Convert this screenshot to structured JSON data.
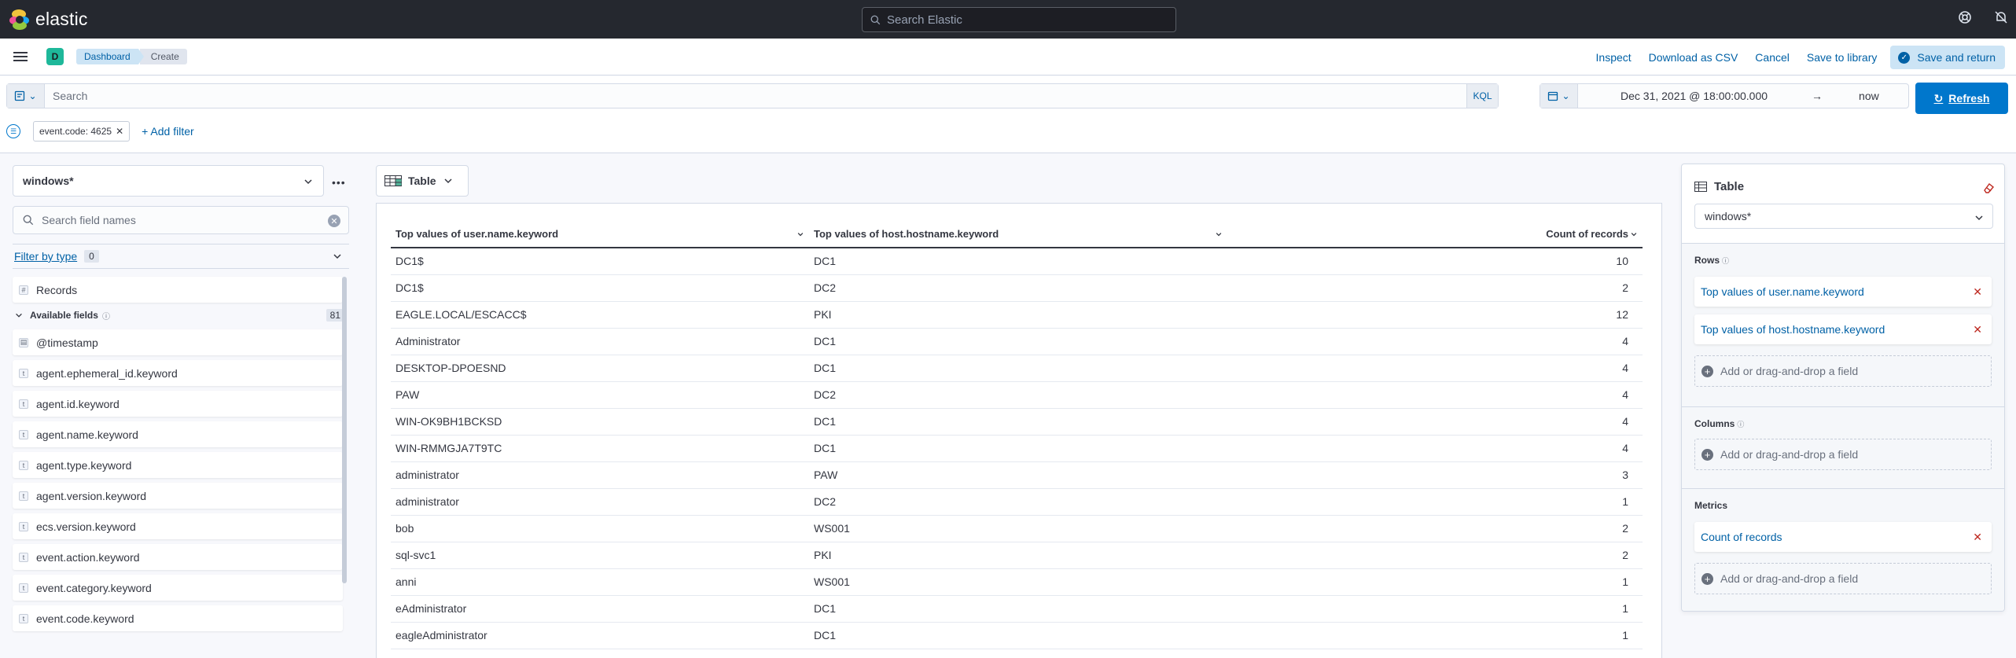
{
  "app": {
    "logo_text": "elastic",
    "global_search_placeholder": "Search Elastic"
  },
  "nav": {
    "space_initial": "D",
    "breadcrumbs": [
      "Dashboard",
      "Create"
    ],
    "actions": [
      "Inspect",
      "Download as CSV",
      "Cancel",
      "Save to library"
    ],
    "save_return_label": "Save and return"
  },
  "query": {
    "placeholder": "Search",
    "language": "KQL",
    "date_start": "Dec 31, 2021 @ 18:00:00.000",
    "date_arrow": "→",
    "date_end": "now",
    "refresh_label": "Refresh",
    "filter_pill": "event.code: 4625",
    "add_filter": "+ Add filter"
  },
  "left_panel": {
    "index_pattern": "windows*",
    "field_search_placeholder": "Search field names",
    "filter_by_type": "Filter by type",
    "filter_count": "0",
    "records_label": "Records",
    "available_label": "Available fields",
    "available_count": "81",
    "fields": [
      {
        "name": "@timestamp",
        "type": "date"
      },
      {
        "name": "agent.ephemeral_id.keyword",
        "type": "t"
      },
      {
        "name": "agent.id.keyword",
        "type": "t"
      },
      {
        "name": "agent.name.keyword",
        "type": "t"
      },
      {
        "name": "agent.type.keyword",
        "type": "t"
      },
      {
        "name": "agent.version.keyword",
        "type": "t"
      },
      {
        "name": "ecs.version.keyword",
        "type": "t"
      },
      {
        "name": "event.action.keyword",
        "type": "t"
      },
      {
        "name": "event.category.keyword",
        "type": "t"
      },
      {
        "name": "event.code.keyword",
        "type": "t"
      }
    ]
  },
  "workspace": {
    "vis_type": "Table",
    "columns": [
      "Top values of user.name.keyword",
      "Top values of host.hostname.keyword",
      "Count of records"
    ],
    "rows": [
      [
        "DC1$",
        "DC1",
        "10"
      ],
      [
        "DC1$",
        "DC2",
        "2"
      ],
      [
        "EAGLE.LOCAL/ESCACC$",
        "PKI",
        "12"
      ],
      [
        "Administrator",
        "DC1",
        "4"
      ],
      [
        "DESKTOP-DPOESND",
        "DC1",
        "4"
      ],
      [
        "PAW",
        "DC2",
        "4"
      ],
      [
        "WIN-OK9BH1BCKSD",
        "DC1",
        "4"
      ],
      [
        "WIN-RMMGJA7T9TC",
        "DC1",
        "4"
      ],
      [
        "administrator",
        "PAW",
        "3"
      ],
      [
        "administrator",
        "DC2",
        "1"
      ],
      [
        "bob",
        "WS001",
        "2"
      ],
      [
        "sql-svc1",
        "PKI",
        "2"
      ],
      [
        "anni",
        "WS001",
        "1"
      ],
      [
        "eAdministrator",
        "DC1",
        "1"
      ],
      [
        "eagleAdministrator",
        "DC1",
        "1"
      ]
    ]
  },
  "config": {
    "title": "Table",
    "index_pattern": "windows*",
    "rows_label": "Rows",
    "row_dimensions": [
      "Top values of user.name.keyword",
      "Top values of host.hostname.keyword"
    ],
    "columns_label": "Columns",
    "metrics_label": "Metrics",
    "metric": "Count of records",
    "add_field_label": "Add or drag-and-drop a field"
  },
  "colors": {
    "accent": "#0077cc",
    "link": "#0061a6",
    "header_bg": "#25282f",
    "danger": "#bd271e"
  }
}
